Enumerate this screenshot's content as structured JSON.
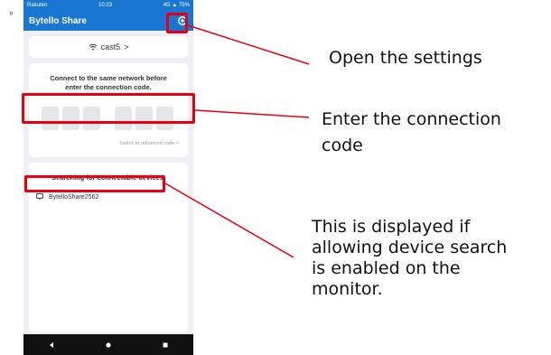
{
  "bullet": "◦",
  "status_bar": {
    "carrier": "Rakuten",
    "time": "10:23",
    "right": "4G ▲ 75%"
  },
  "app_bar": {
    "title": "Bytello Share"
  },
  "wifi": {
    "network": "cast5",
    "chevron": ">"
  },
  "code_card": {
    "instruction_line1": "Connect to the same network before",
    "instruction_line2": "enter the connection code.",
    "advanced_link": "Switch to advanced code >"
  },
  "devices_card": {
    "searching_text": "Searching for connectable devices.",
    "devices": [
      "BytelloShare2562"
    ]
  },
  "callouts": {
    "settings": "Open the settings",
    "code_line1": "Enter the connection",
    "code_line2": "code",
    "search_line1": "This is displayed if",
    "search_line2": "allowing device search",
    "search_line3": "is enabled on the",
    "search_line4": "monitor."
  },
  "colors": {
    "accent": "#1976d2",
    "highlight": "#e60012"
  }
}
